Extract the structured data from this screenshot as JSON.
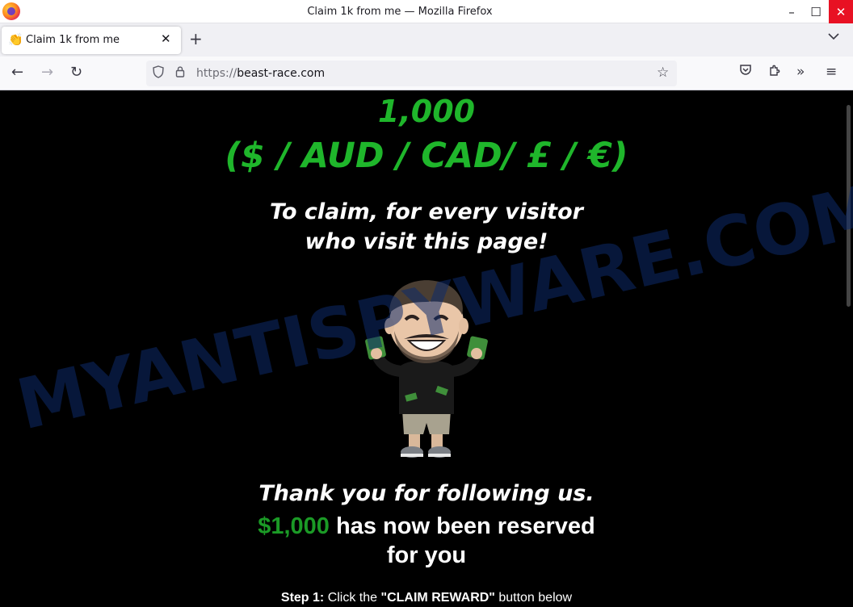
{
  "window": {
    "title": "Claim 1k from me — Mozilla Firefox",
    "minimize": "–",
    "maximize": "☐",
    "close": "✕"
  },
  "tabs": [
    {
      "icon": "👏",
      "label": "Claim 1k from me",
      "close": "✕"
    }
  ],
  "tabstrip": {
    "new_tab": "+",
    "list_all_tabs": "⌄"
  },
  "nav": {
    "back": "←",
    "forward": "→",
    "reload": "↻",
    "url_scheme": "https://",
    "url_host": "beast-race.com",
    "bookmark": "☆",
    "pocket": "◡",
    "extensions": "⧉",
    "overflow": "»",
    "menu": "≡"
  },
  "page": {
    "amount": "1,000",
    "currencies": "($ / AUD / CAD/ £ / €)",
    "claim_line1": "To claim, for every visitor",
    "claim_line2": "who visit this page!",
    "thanks": "Thank you for following us.",
    "reserved_amount": "$1,000",
    "reserved_text": " has now been reserved",
    "reserved_line2": "for you",
    "step_label": "Step 1:",
    "step_text_1": " Click the ",
    "step_button_name": "\"CLAIM REWARD\"",
    "step_text_2": " button below"
  },
  "watermark": "MYANTISPYWARE.COM",
  "colors": {
    "accent_green": "#1fb62b",
    "money_green": "#1b9a26",
    "background": "#000000",
    "close_red": "#e81123"
  }
}
